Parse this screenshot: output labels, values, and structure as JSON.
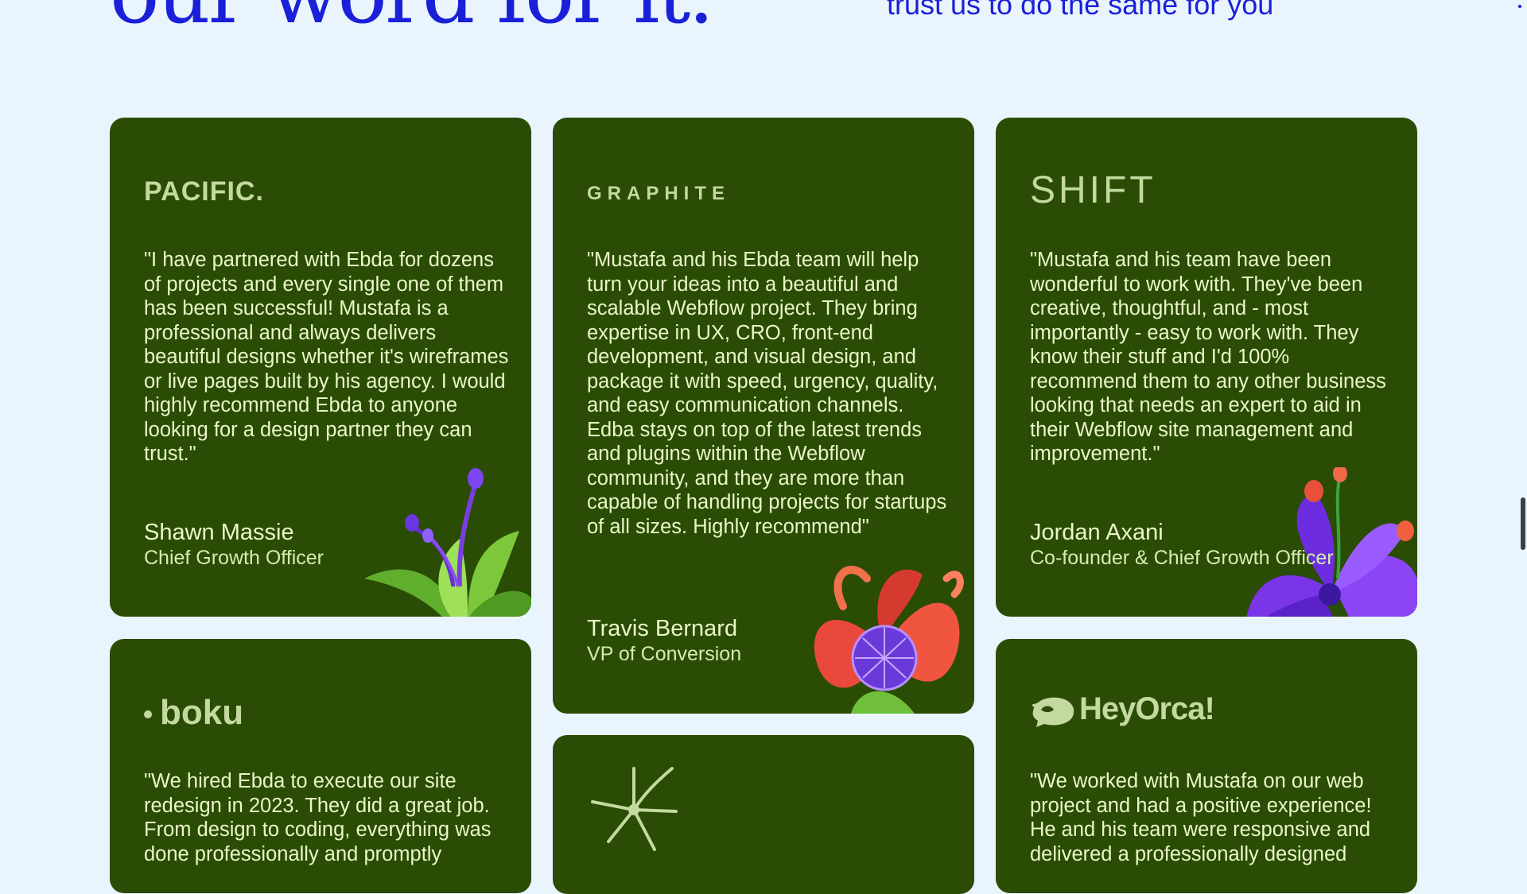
{
  "header": {
    "headline": "our word for it.",
    "subhead": "trust us to do the same for you"
  },
  "colors": {
    "background": "#eaf4fc",
    "accent": "#1a20d8",
    "card": "#2a4c05",
    "card_text": "#eaf7c7"
  },
  "testimonials": [
    {
      "logo": "PACIFIC.",
      "quote": "\"I have partnered with Ebda for dozens of projects and every single one of them has been successful! Mustafa is a professional and always delivers beautiful designs whether it's wireframes or live pages built by his agency. I would highly recommend Ebda to anyone looking for a design partner they can trust.\"",
      "name": "Shawn Massie",
      "role": "Chief Growth Officer",
      "decoration": "green-succulent-purple-bud"
    },
    {
      "logo": "GRAPHITE",
      "quote": "\"Mustafa and his Ebda team will help turn your ideas into a beautiful and scalable Webflow project. They bring expertise in UX, CRO, front-end development, and visual design, and package it with speed, urgency, quality, and easy communication channels. Edba stays on top of the latest trends and plugins within the Webflow community, and they are more than capable of handling projects for startups of all sizes. Highly recommend\"",
      "name": "Travis Bernard",
      "role": "VP of Conversion",
      "decoration": "red-flower-purple-orb"
    },
    {
      "logo": "SHIFT",
      "quote": "\"Mustafa and his team have been wonderful to work with. They've been creative, thoughtful, and - most importantly - easy to work with. They know their stuff and I'd 100% recommend them to any other business looking that needs an expert to aid in their Webflow site management and improvement.\"",
      "name": "Jordan Axani",
      "role": "Co-founder & Chief Growth Officer",
      "decoration": "purple-flower"
    },
    {
      "logo": "boku",
      "quote": "\"We hired Ebda to execute our site redesign in 2023. They did a great job. From design to coding, everything was done professionally and promptly"
    },
    {
      "logo": "",
      "logo_icon": "star-burst-icon"
    },
    {
      "logo": "HeyOrca!",
      "logo_icon": "orca-icon",
      "quote": "\"We worked with Mustafa on our web project and had a positive experience! He and his team were responsive and delivered a professionally designed"
    }
  ]
}
